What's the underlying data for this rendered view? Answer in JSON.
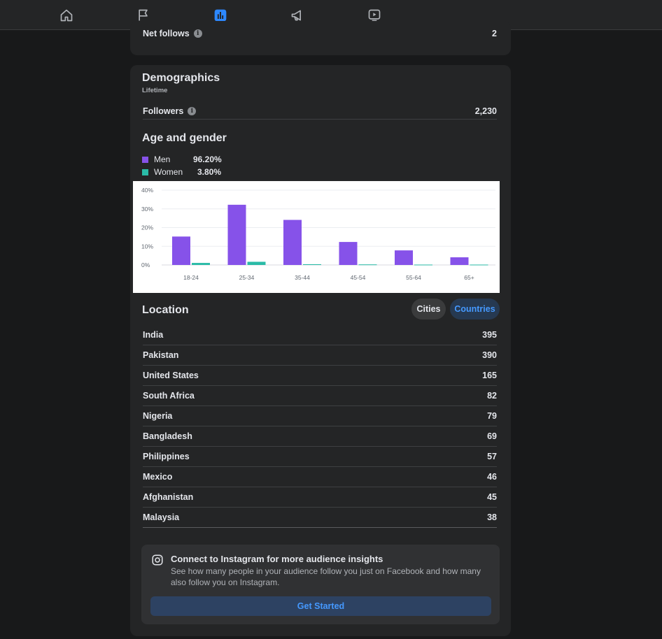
{
  "nav": {
    "tabs": [
      {
        "name": "home",
        "icon": "home-icon"
      },
      {
        "name": "pages",
        "icon": "flag-icon"
      },
      {
        "name": "insights",
        "icon": "bar-chart-icon",
        "active": true
      },
      {
        "name": "ads",
        "icon": "megaphone-icon"
      },
      {
        "name": "video",
        "icon": "video-play-icon"
      }
    ],
    "accent_color": "#2d88ff"
  },
  "net_follows": {
    "label": "Net follows",
    "value": "2"
  },
  "demographics": {
    "title": "Demographics",
    "subtitle": "Lifetime",
    "followers_label": "Followers",
    "followers_value": "2,230",
    "age_gender_title": "Age and gender",
    "legend": [
      {
        "name": "Men",
        "pct": "96.20%",
        "color": "#8652e9"
      },
      {
        "name": "Women",
        "pct": "3.80%",
        "color": "#2abba7"
      }
    ]
  },
  "chart_data": {
    "type": "bar",
    "categories": [
      "18-24",
      "25-34",
      "35-44",
      "45-54",
      "55-64",
      "65+"
    ],
    "series": [
      {
        "name": "Men",
        "values": [
          15.2,
          32.2,
          24.1,
          12.3,
          7.8,
          4.1
        ],
        "color": "#8652e9"
      },
      {
        "name": "Women",
        "values": [
          1.1,
          1.7,
          0.4,
          0.3,
          0.2,
          0.2
        ],
        "color": "#2abba7"
      }
    ],
    "yticks": [
      "0%",
      "10%",
      "20%",
      "30%",
      "40%"
    ],
    "ylim": [
      0,
      40
    ],
    "grid": true
  },
  "location": {
    "title": "Location",
    "cities_label": "Cities",
    "countries_label": "Countries",
    "rows": [
      {
        "name": "India",
        "value": "395"
      },
      {
        "name": "Pakistan",
        "value": "390"
      },
      {
        "name": "United States",
        "value": "165"
      },
      {
        "name": "South Africa",
        "value": "82"
      },
      {
        "name": "Nigeria",
        "value": "79"
      },
      {
        "name": "Bangladesh",
        "value": "69"
      },
      {
        "name": "Philippines",
        "value": "57"
      },
      {
        "name": "Mexico",
        "value": "46"
      },
      {
        "name": "Afghanistan",
        "value": "45"
      },
      {
        "name": "Malaysia",
        "value": "38"
      }
    ]
  },
  "instagram": {
    "title": "Connect to Instagram for more audience insights",
    "description": "See how many people in your audience follow you just on Facebook and how many also follow you on Instagram.",
    "button_label": "Get Started",
    "icon": "instagram-icon"
  }
}
